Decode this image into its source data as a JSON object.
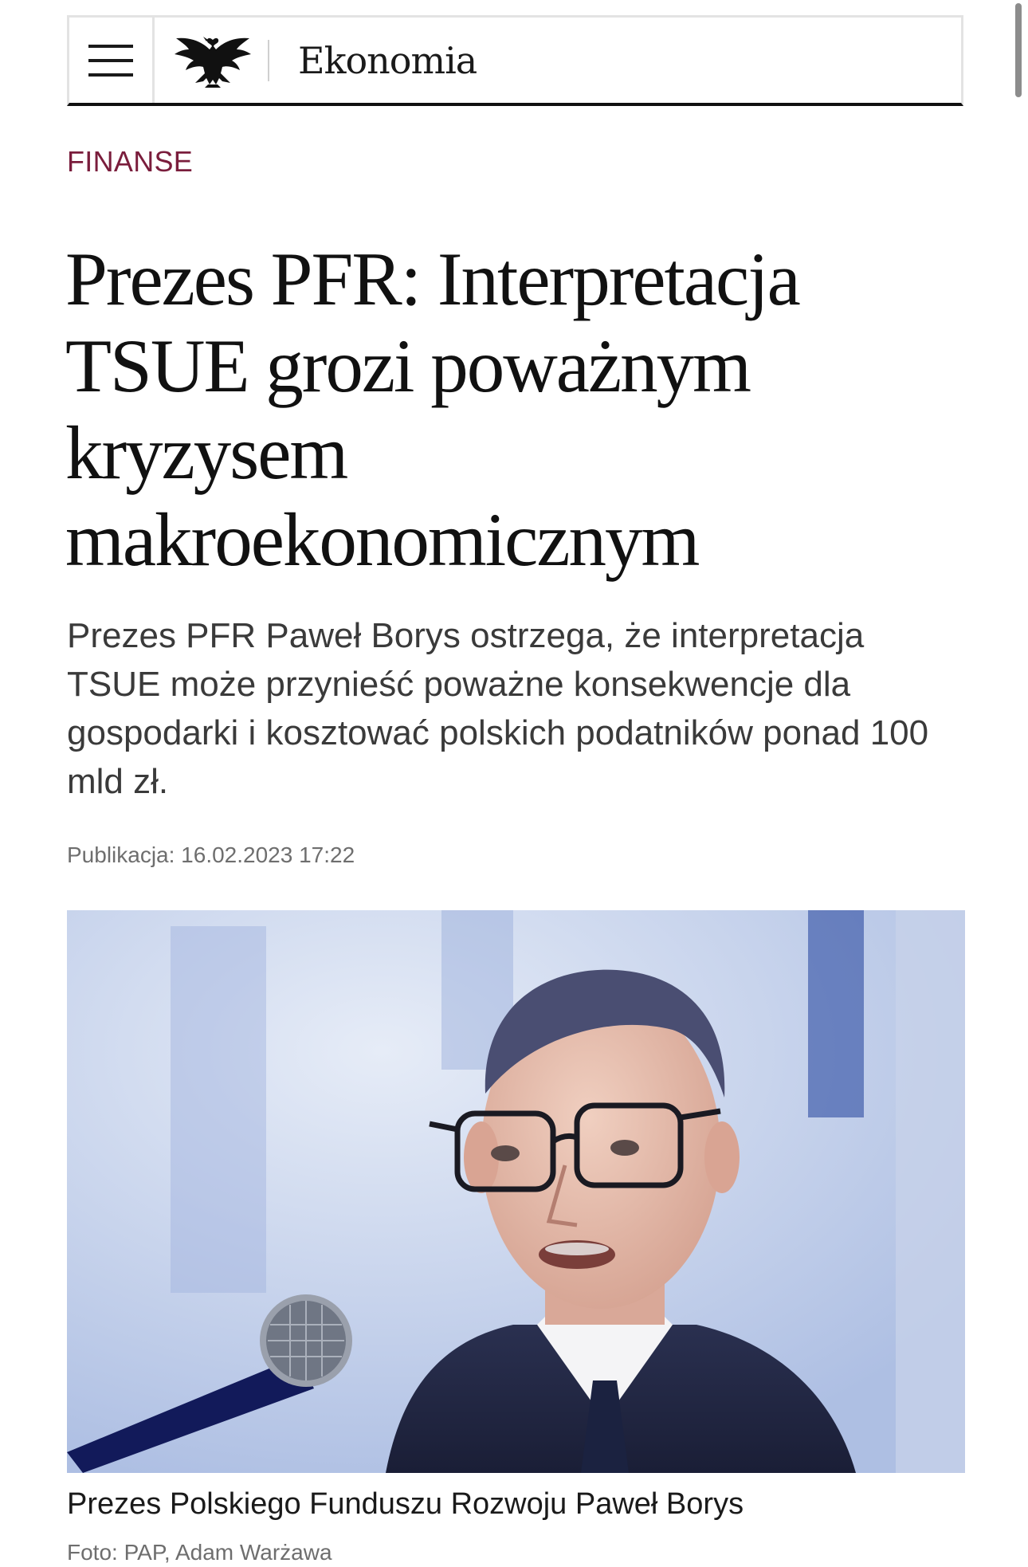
{
  "header": {
    "section": "Ekonomia",
    "logo_icon": "eagle-logo-icon",
    "menu_icon": "hamburger-menu-icon"
  },
  "article": {
    "category": "FINANSE",
    "headline": "Prezes PFR: Interpretacja TSUE grozi poważnym kryzysem makroekonomicznym",
    "lead": "Prezes PFR Paweł Borys ostrzega, że interpretacja TSUE może przynieść poważne konsekwencje dla gospodarki i kosztować polskich podatników ponad 100 mld zł.",
    "published": "Publikacja: 16.02.2023 17:22",
    "image_caption": "Prezes Polskiego Funduszu Rozwoju Paweł Borys",
    "image_credit": "Foto: PAP, Adam Warżawa"
  },
  "colors": {
    "category": "#7a1d3c",
    "header_border": "#111111"
  }
}
